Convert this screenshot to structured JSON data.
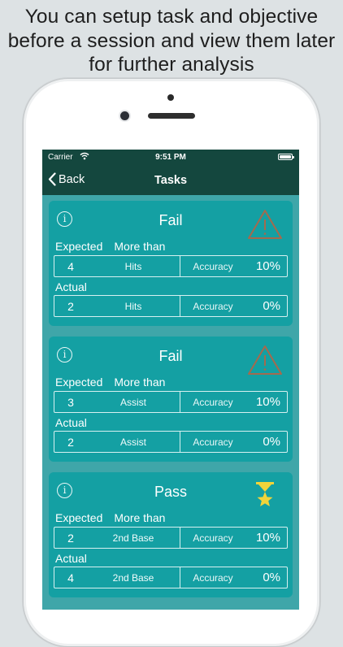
{
  "caption": {
    "lines": [
      "You can setup task and objective",
      "before a session and view them later",
      "for further analysis"
    ]
  },
  "status_bar": {
    "carrier": "Carrier",
    "time": "9:51 PM"
  },
  "nav": {
    "back_label": "Back",
    "title": "Tasks"
  },
  "icons": {
    "info": "info-circle-icon",
    "fail": "warning-triangle-icon",
    "pass": "trophy-icon",
    "back": "chevron-left-icon"
  },
  "colors": {
    "header": "#14473e",
    "screen_bg": "#3fa6a9",
    "card_bg": "#14a0a3",
    "warning": "#a46a4e",
    "trophy": "#f0d43a"
  },
  "cards": [
    {
      "result": "Fail",
      "status_icon": "warning-triangle-icon",
      "expected_label": "Expected",
      "comparison": "More than",
      "expected": {
        "value": "4",
        "unit": "Hits",
        "accuracy_label": "Accuracy",
        "accuracy": "10%"
      },
      "actual_label": "Actual",
      "actual": {
        "value": "2",
        "unit": "Hits",
        "accuracy_label": "Accuracy",
        "accuracy": "0%"
      }
    },
    {
      "result": "Fail",
      "status_icon": "warning-triangle-icon",
      "expected_label": "Expected",
      "comparison": "More than",
      "expected": {
        "value": "3",
        "unit": "Assist",
        "accuracy_label": "Accuracy",
        "accuracy": "10%"
      },
      "actual_label": "Actual",
      "actual": {
        "value": "2",
        "unit": "Assist",
        "accuracy_label": "Accuracy",
        "accuracy": "0%"
      }
    },
    {
      "result": "Pass",
      "status_icon": "trophy-icon",
      "expected_label": "Expected",
      "comparison": "More than",
      "expected": {
        "value": "2",
        "unit": "2nd Base",
        "accuracy_label": "Accuracy",
        "accuracy": "10%"
      },
      "actual_label": "Actual",
      "actual": {
        "value": "4",
        "unit": "2nd Base",
        "accuracy_label": "Accuracy",
        "accuracy": "0%"
      }
    }
  ]
}
